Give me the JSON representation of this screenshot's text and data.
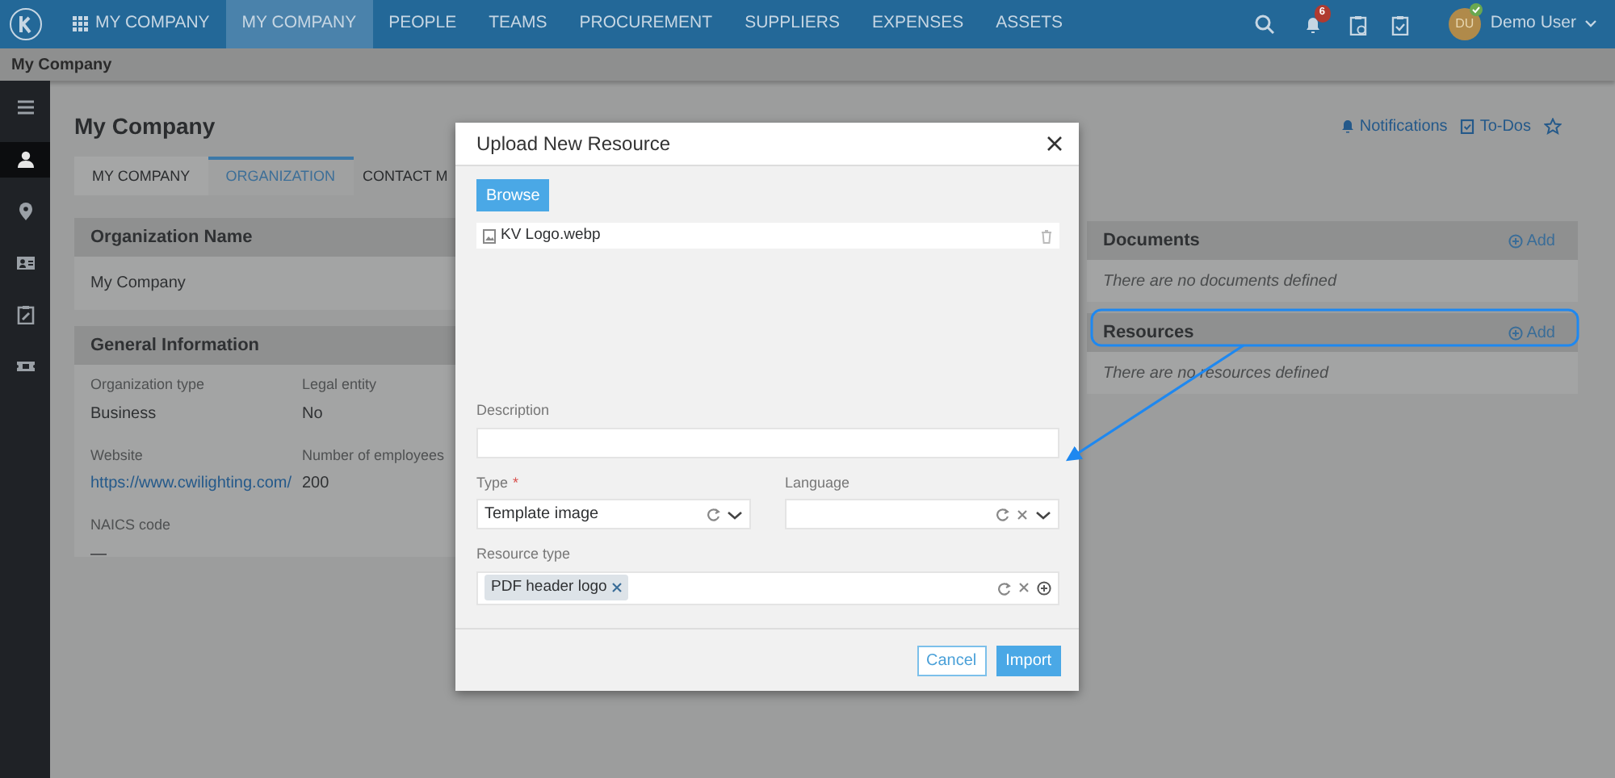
{
  "navbar": {
    "app_menu": "MY COMPANY",
    "items": [
      {
        "label": "MY COMPANY",
        "selected": true
      },
      {
        "label": "PEOPLE",
        "selected": false
      },
      {
        "label": "TEAMS",
        "selected": false
      },
      {
        "label": "PROCUREMENT",
        "selected": false
      },
      {
        "label": "SUPPLIERS",
        "selected": false
      },
      {
        "label": "EXPENSES",
        "selected": false
      },
      {
        "label": "ASSETS",
        "selected": false
      }
    ],
    "notification_count": "6",
    "user": {
      "initials": "DU",
      "name": "Demo User"
    }
  },
  "breadcrumb": "My Company",
  "sidebar": {
    "items": [
      {
        "kind": "menu",
        "selected": false
      },
      {
        "kind": "person",
        "selected": true
      },
      {
        "kind": "pin",
        "selected": false
      },
      {
        "kind": "card",
        "selected": false
      },
      {
        "kind": "clipboard",
        "selected": false
      },
      {
        "kind": "ticket",
        "selected": false
      }
    ]
  },
  "page": {
    "title": "My Company",
    "links": [
      "Notifications",
      "To-Dos"
    ],
    "tabs": [
      {
        "label": "MY COMPANY",
        "selected": false
      },
      {
        "label": "ORGANIZATION",
        "selected": true
      },
      {
        "label": "CONTACT M",
        "selected": false
      }
    ],
    "organization_name": {
      "title": "Organization Name",
      "value": "My Company"
    },
    "general_information": {
      "title": "General Information",
      "fields": [
        {
          "label": "Organization type",
          "value": "Business",
          "kind": "text"
        },
        {
          "label": "Legal entity",
          "value": "No",
          "kind": "text"
        },
        {
          "label": "Website",
          "value": "https://www.cwilighting.com/",
          "kind": "link"
        },
        {
          "label": "Number of employees",
          "value": "200",
          "kind": "text"
        },
        {
          "label": "NAICS code",
          "value": "—",
          "kind": "text"
        }
      ]
    },
    "panels": [
      {
        "title": "Documents",
        "action": "Add",
        "empty_text": "There are no documents defined"
      },
      {
        "title": "Resources",
        "action": "Add",
        "empty_text": "There are no resources defined"
      }
    ]
  },
  "modal": {
    "title": "Upload New Resource",
    "browse": "Browse",
    "file": "KV Logo.webp",
    "description": {
      "label": "Description"
    },
    "type": {
      "label": "Type",
      "required_mark": "*",
      "value": "Template image"
    },
    "language": {
      "label": "Language"
    },
    "resource_type": {
      "label": "Resource type",
      "tags": [
        "PDF header logo"
      ]
    },
    "buttons": {
      "cancel": "Cancel",
      "import": "Import"
    }
  }
}
